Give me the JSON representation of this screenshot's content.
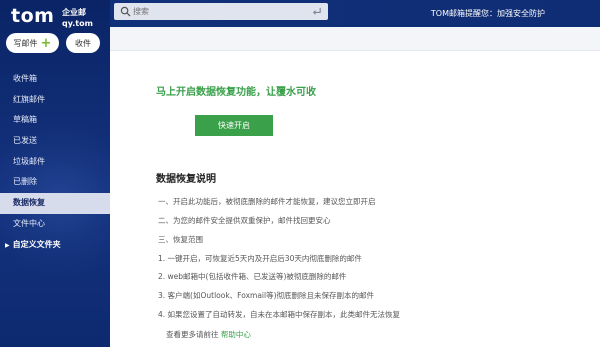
{
  "brand": {
    "logo": "tom",
    "sub_line1": "企业邮",
    "sub_line2": "qy.tom"
  },
  "sidebar": {
    "write_label": "写邮件",
    "receive_label": "收件",
    "items": [
      {
        "label": "收件箱"
      },
      {
        "label": "红旗邮件"
      },
      {
        "label": "草稿箱"
      },
      {
        "label": "已发送"
      },
      {
        "label": "垃圾邮件"
      },
      {
        "label": "已删除"
      },
      {
        "label": "数据恢复"
      },
      {
        "label": "文件中心"
      },
      {
        "label": "自定义文件夹"
      }
    ],
    "active_index": 6
  },
  "topbar": {
    "search_placeholder": "搜索",
    "right_text": "TOM邮箱提醒您：加强安全防护"
  },
  "content": {
    "headline": "马上开启数据恢复功能，让覆水可收",
    "enable_button": "快速开启",
    "section_title": "数据恢复说明",
    "lines": [
      "一、开启此功能后，被彻底删除的邮件才能恢复，建议您立即开启",
      "二、为您的邮件安全提供双重保护，邮件找回更安心",
      "三、恢复范围",
      "1. 一键开启，可恢复近5天内及开启后30天内彻底删除的邮件",
      "2. web邮箱中(包括收件箱、已发送等)被彻底删除的邮件",
      "3. 客户端(如Outlook、Foxmail等)彻底删除且未保存副本的邮件",
      "4. 如果您设置了自动转发，自未在本邮箱中保存副本，此类邮件无法恢复"
    ],
    "help_prefix": "查看更多请前往",
    "help_link": "帮助中心"
  },
  "colors": {
    "sidebar_bg": "#0f2a72",
    "accent_green": "#3aa04a",
    "active_item_bg": "#d6dcec"
  }
}
